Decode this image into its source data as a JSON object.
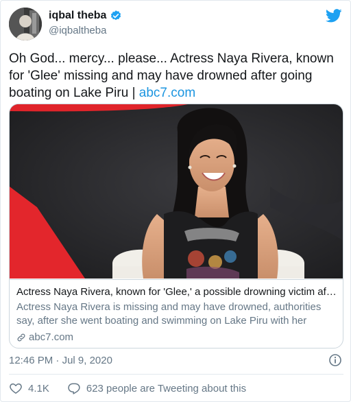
{
  "author": {
    "name": "iqbal theba",
    "handle": "@iqbaltheba",
    "verified": true
  },
  "tweet": {
    "text_main": "Oh God... mercy... please... Actress Naya Rivera, known for 'Glee' missing and may have drowned after going boating on Lake Piru | ",
    "link_text": "abc7.com"
  },
  "card": {
    "image_alt": "Photo of Naya Rivera smiling",
    "title": "Actress Naya Rivera, known for 'Glee,' a possible drowning victim aft...",
    "description": "Actress Naya Rivera is missing and may have drowned, authorities say, after she went boating and swimming on Lake Piru with her young ...",
    "domain": "abc7.com"
  },
  "meta": {
    "time": "12:46 PM",
    "separator": " · ",
    "date": "Jul 9, 2020"
  },
  "actions": {
    "likes": "4.1K",
    "conversation": "623 people are Tweeting about this"
  },
  "colors": {
    "twitter_blue": "#1da1f2",
    "link_blue": "#1b95e0",
    "secondary_text": "#657786",
    "like_red": "#e0245e"
  },
  "icons": [
    "verified-badge-icon",
    "twitter-bird-icon",
    "link-chain-icon",
    "info-icon",
    "heart-icon",
    "speech-bubble-icon"
  ]
}
